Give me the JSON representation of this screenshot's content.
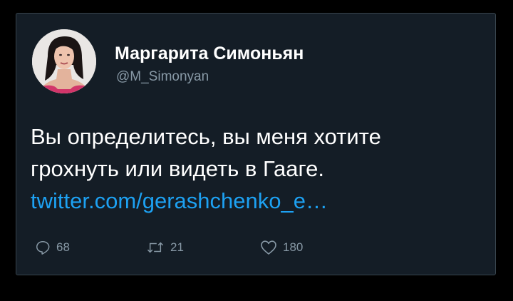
{
  "tweet": {
    "author_name": "Маргарита Симоньян",
    "handle": "@M_Simonyan",
    "text_lines": [
      "Вы определитесь, вы меня хотите",
      "грохнуть или видеть в Гааге."
    ],
    "link": "twitter.com/gerashchenko_e…",
    "stats": {
      "replies": "68",
      "retweets": "21",
      "likes": "180"
    }
  },
  "icons": {
    "reply": "comment-bubble-icon",
    "retweet": "retweet-arrows-icon",
    "like": "heart-icon"
  },
  "colors": {
    "background": "#000000",
    "card": "#141d26",
    "border": "#38444d",
    "text": "#ffffff",
    "secondary": "#8899a6",
    "link": "#1da1f2"
  }
}
